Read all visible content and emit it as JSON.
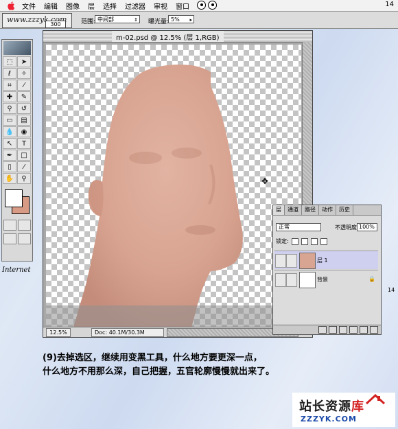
{
  "menubar": {
    "items": [
      "文件",
      "编辑",
      "图像",
      "层",
      "选择",
      "过滤器",
      "审视",
      "窗口"
    ],
    "page_number": "14"
  },
  "options_bar": {
    "tool_watermark": "www.zzzyk.com",
    "brush_size": "300",
    "range_label": "范围:",
    "range_value": "中间部",
    "exposure_label": "曝光量:",
    "exposure_value": "5%"
  },
  "toolbox": {
    "foreground_color": "#ffffff",
    "background_color": "#d79a84",
    "internet_label": "Internet"
  },
  "document": {
    "title": "m-02.psd @ 12.5% (层 1,RGB)",
    "zoom": "12.5%",
    "doc_info": "Doc: 40.1M/30.3M"
  },
  "layers_panel": {
    "tabs": [
      "层",
      "通道",
      "路径",
      "动作",
      "历史"
    ],
    "blend_mode": "正常",
    "opacity_label": "不透明度:",
    "opacity_value": "100%",
    "lock_label": "锁定:",
    "layers": [
      {
        "name": "层 1",
        "selected": true
      },
      {
        "name": "背景",
        "selected": false
      }
    ]
  },
  "caption": {
    "line1": "(9)去掉选区，继续用变黑工具，什么地方要更深一点，",
    "line2": "什么地方不用那么深，自己把握，五官轮廓慢慢就出来了。"
  },
  "side_label": "14",
  "watermark": {
    "title_part1": "站长资源",
    "title_part2": "库",
    "url": "ZZZYK.COM"
  },
  "colors": {
    "skin": "#d9a593",
    "layer_selected": "#cfcff0",
    "watermark_red": "#d42222",
    "watermark_blue": "#1b4aa8"
  }
}
